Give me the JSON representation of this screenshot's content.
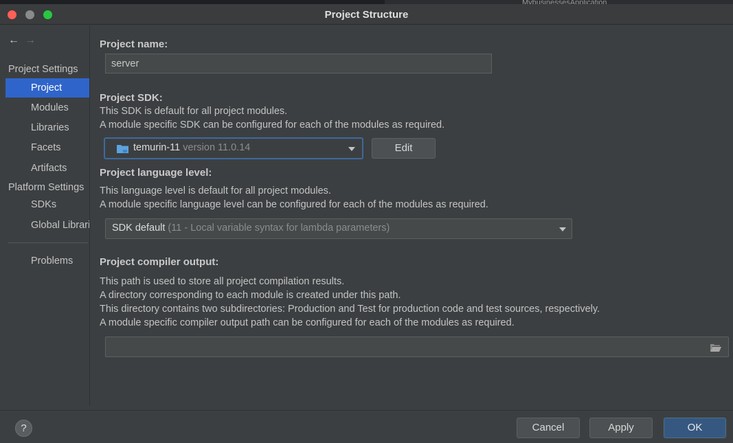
{
  "background_app": {
    "run_config": "MybusinessesApplication"
  },
  "window": {
    "title": "Project Structure"
  },
  "sidebar": {
    "project_settings_header": "Project Settings",
    "platform_settings_header": "Platform Settings",
    "items": [
      {
        "label": "Project",
        "selected": true
      },
      {
        "label": "Modules"
      },
      {
        "label": "Libraries"
      },
      {
        "label": "Facets"
      },
      {
        "label": "Artifacts"
      }
    ],
    "platform_items": [
      {
        "label": "SDKs"
      },
      {
        "label": "Global Libraries"
      }
    ],
    "problems_label": "Problems"
  },
  "project": {
    "name_label": "Project name:",
    "name_value": "server",
    "sdk_label": "Project SDK:",
    "sdk_desc_1": "This SDK is default for all project modules.",
    "sdk_desc_2": "A module specific SDK can be configured for each of the modules as required.",
    "sdk_name": "temurin-11",
    "sdk_version": "version 11.0.14",
    "edit_label": "Edit",
    "language_label": "Project language level:",
    "language_desc_1": "This language level is default for all project modules.",
    "language_desc_2": "A module specific language level can be configured for each of the modules as required.",
    "language_value": "SDK default",
    "language_detail": "(11 - Local variable syntax for lambda parameters)",
    "compiler_label": "Project compiler output:",
    "compiler_desc_1": "This path is used to store all project compilation results.",
    "compiler_desc_2": "A directory corresponding to each module is created under this path.",
    "compiler_desc_3": "This directory contains two subdirectories: Production and Test for production code and test sources, respectively.",
    "compiler_desc_4": "A module specific compiler output path can be configured for each of the modules as required.",
    "compiler_path": ""
  },
  "footer": {
    "help_label": "?",
    "cancel_label": "Cancel",
    "apply_label": "Apply",
    "ok_label": "OK"
  },
  "colors": {
    "selection": "#2f65ca",
    "primary_button": "#365880",
    "focus_border": "#3d6a9e",
    "sdk_folder_icon": "#5ba3e0"
  }
}
